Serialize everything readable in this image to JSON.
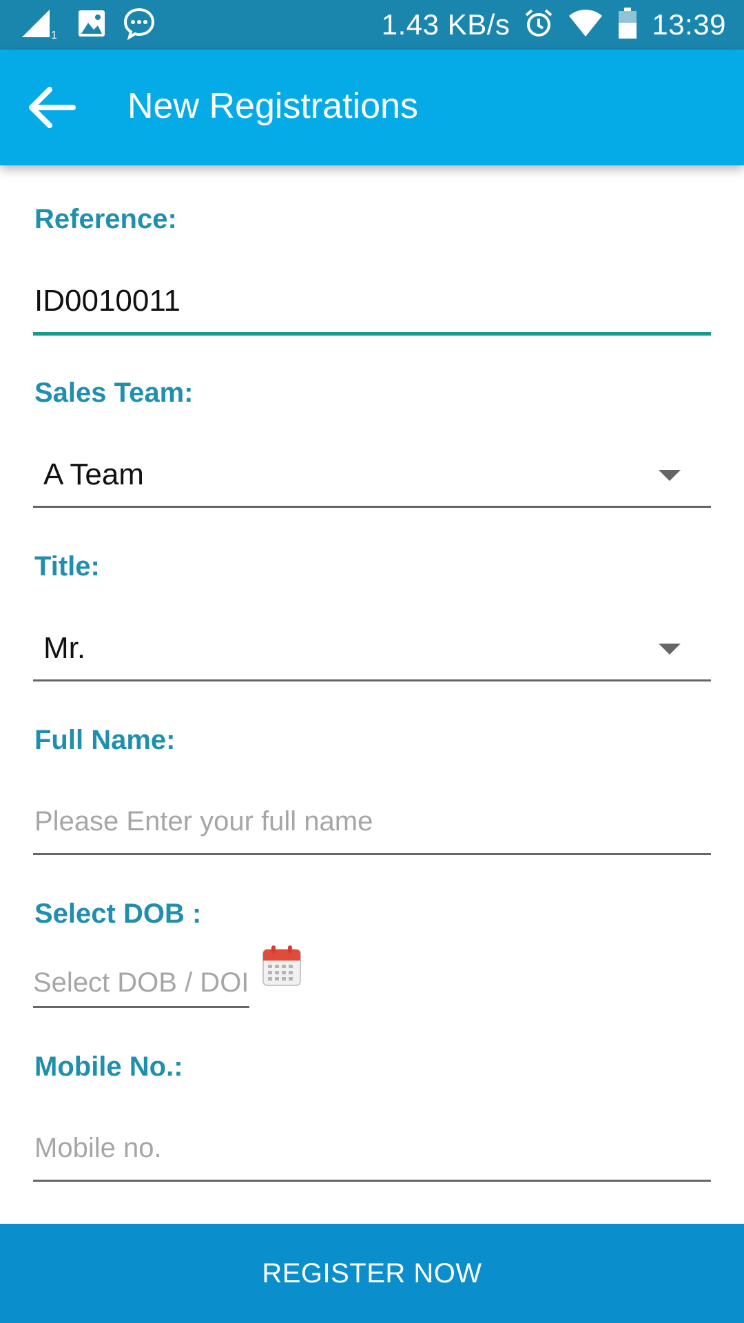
{
  "status_bar": {
    "network_speed": "1.43 KB/s",
    "time": "13:39",
    "sim_indicator": "1",
    "icons_left": [
      "signal-icon",
      "gallery-icon",
      "messenger-icon"
    ],
    "icons_right": [
      "alarm-icon",
      "wifi-icon",
      "battery-icon"
    ]
  },
  "app_bar": {
    "title": "New Registrations",
    "back_icon": "arrow-back-icon"
  },
  "form": {
    "reference": {
      "label": "Reference:",
      "value": "ID0010011"
    },
    "sales_team": {
      "label": "Sales Team:",
      "value": "A Team"
    },
    "title": {
      "label": "Title:",
      "value": "Mr."
    },
    "full_name": {
      "label": "Full Name:",
      "placeholder": "Please Enter your full name"
    },
    "dob": {
      "label": "Select  DOB :",
      "placeholder": "Select DOB / DOI",
      "icon": "calendar-icon"
    },
    "mobile": {
      "label": "Mobile No.:",
      "placeholder": "Mobile no."
    }
  },
  "register_button": {
    "label": "REGISTER NOW"
  },
  "colors": {
    "status_bar": "#1a86ad",
    "app_bar": "#05abe6",
    "label": "#1f8fad",
    "focused_underline": "#179b8c",
    "button": "#0a8fcc"
  }
}
